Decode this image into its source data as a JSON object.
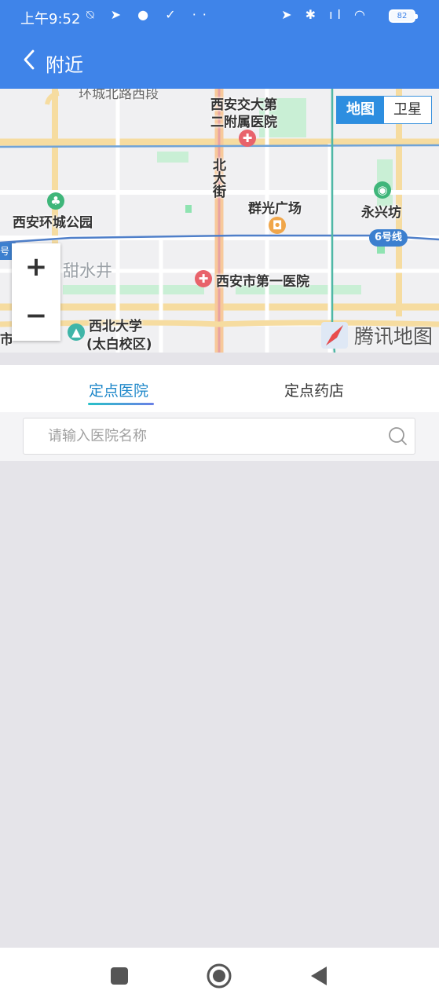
{
  "status_bar": {
    "time": "上午9:52",
    "left_icons": "⍉ ➤ ● ✓ ··",
    "right_icons": "➤ ✱ ıl ◠",
    "battery": "82"
  },
  "header": {
    "title": "附近",
    "back_icon": "chevron-left-icon"
  },
  "map": {
    "map_type": {
      "map": "地图",
      "satellite": "卫星"
    },
    "labels": {
      "top_road": "环城北路西段",
      "hospital2_line1": "西安交大第",
      "hospital2_line2": "二附属医院",
      "street": "北大街",
      "park": "西安环城公园",
      "plaza": "群光广场",
      "yongxing": "永兴坊",
      "metro6": "6号线",
      "metro_left": "号线",
      "tianshuijing": "甜水井",
      "hospital1": "西安市第一医院",
      "univ_line1": "西北大学",
      "univ_line2": "(太白校区)",
      "edge_left": "市"
    },
    "zoom": {
      "in": "+",
      "out": "−"
    },
    "brand": "腾讯地图"
  },
  "tabs": {
    "hospital": "定点医院",
    "pharmacy": "定点药店",
    "active": "hospital"
  },
  "search": {
    "placeholder": "请输入医院名称",
    "value": ""
  },
  "colors": {
    "primary": "#3f84e9",
    "tab_active": "#1d87c9",
    "background": "#e5e4e9"
  }
}
